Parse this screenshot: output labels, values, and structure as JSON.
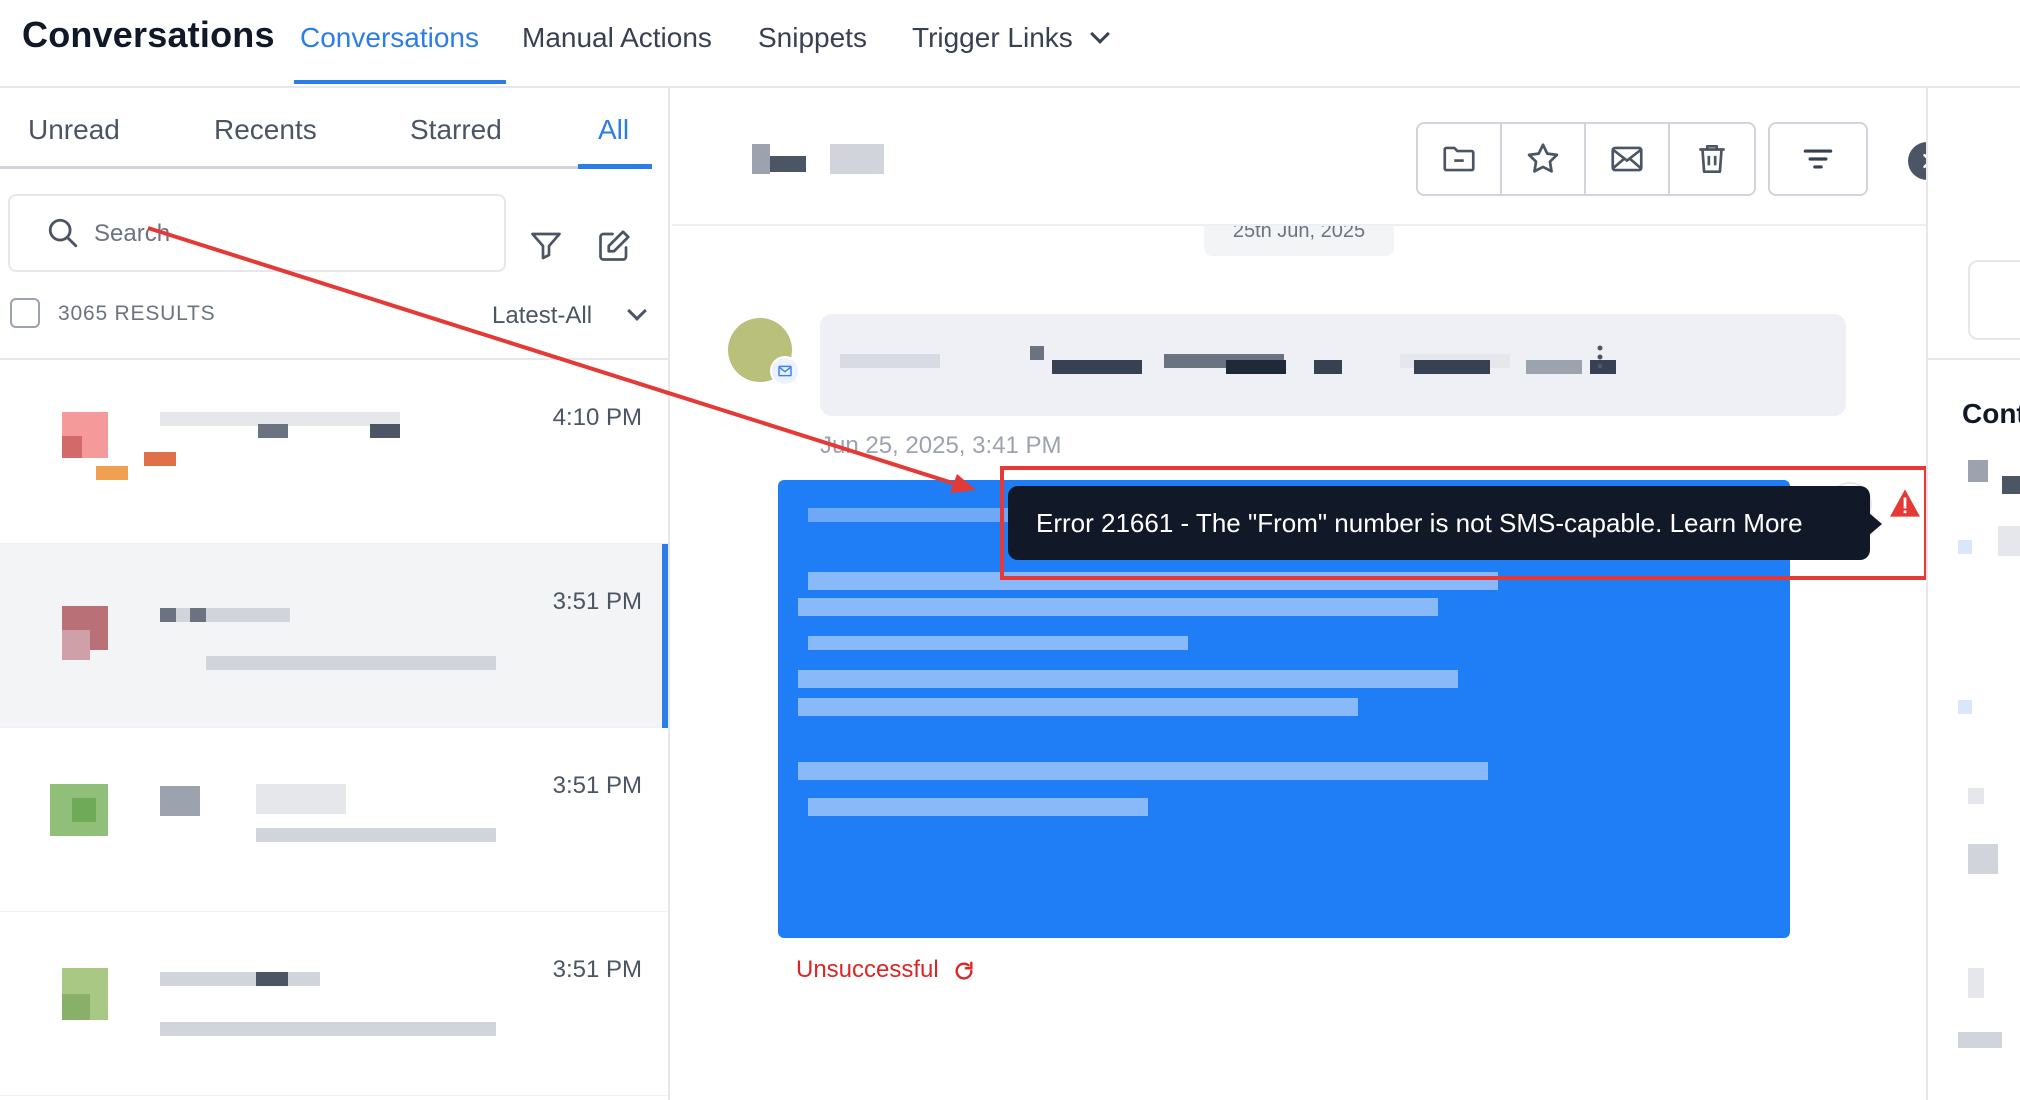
{
  "header": {
    "title": "Conversations",
    "tabs": [
      {
        "label": "Conversations",
        "active": true
      },
      {
        "label": "Manual Actions"
      },
      {
        "label": "Snippets"
      },
      {
        "label": "Trigger Links"
      }
    ]
  },
  "inbox": {
    "tabs": [
      {
        "label": "Unread"
      },
      {
        "label": "Recents"
      },
      {
        "label": "Starred"
      },
      {
        "label": "All",
        "active": true
      }
    ],
    "search_placeholder": "Search",
    "results_count": "3065 RESULTS",
    "sort_label": "Latest-All",
    "conversations": [
      {
        "time": "4:10 PM"
      },
      {
        "time": "3:51 PM",
        "selected": true
      },
      {
        "time": "3:51 PM"
      },
      {
        "time": "3:51 PM"
      }
    ]
  },
  "thread": {
    "date_divider": "25th Jun, 2025",
    "message_timestamp": "Jun 25, 2025, 3:41 PM",
    "status": "Unsuccessful",
    "error_tooltip": "Error 21661 - The \"From\" number is not SMS-capable. Learn More"
  },
  "contact_panel": {
    "title": "Cont"
  },
  "colors": {
    "accent": "#2b7de9",
    "outgoing_bubble": "#1f7ef5",
    "error": "#dc2626",
    "annotation": "#e53935",
    "tooltip_bg": "#111827"
  },
  "icons": [
    "search-icon",
    "filter-icon",
    "compose-icon",
    "folder-icon",
    "star-icon",
    "mail-icon",
    "trash-icon",
    "sort-filter-icon",
    "chevron-right-icon",
    "email-badge-icon",
    "warning-icon",
    "retry-icon"
  ]
}
